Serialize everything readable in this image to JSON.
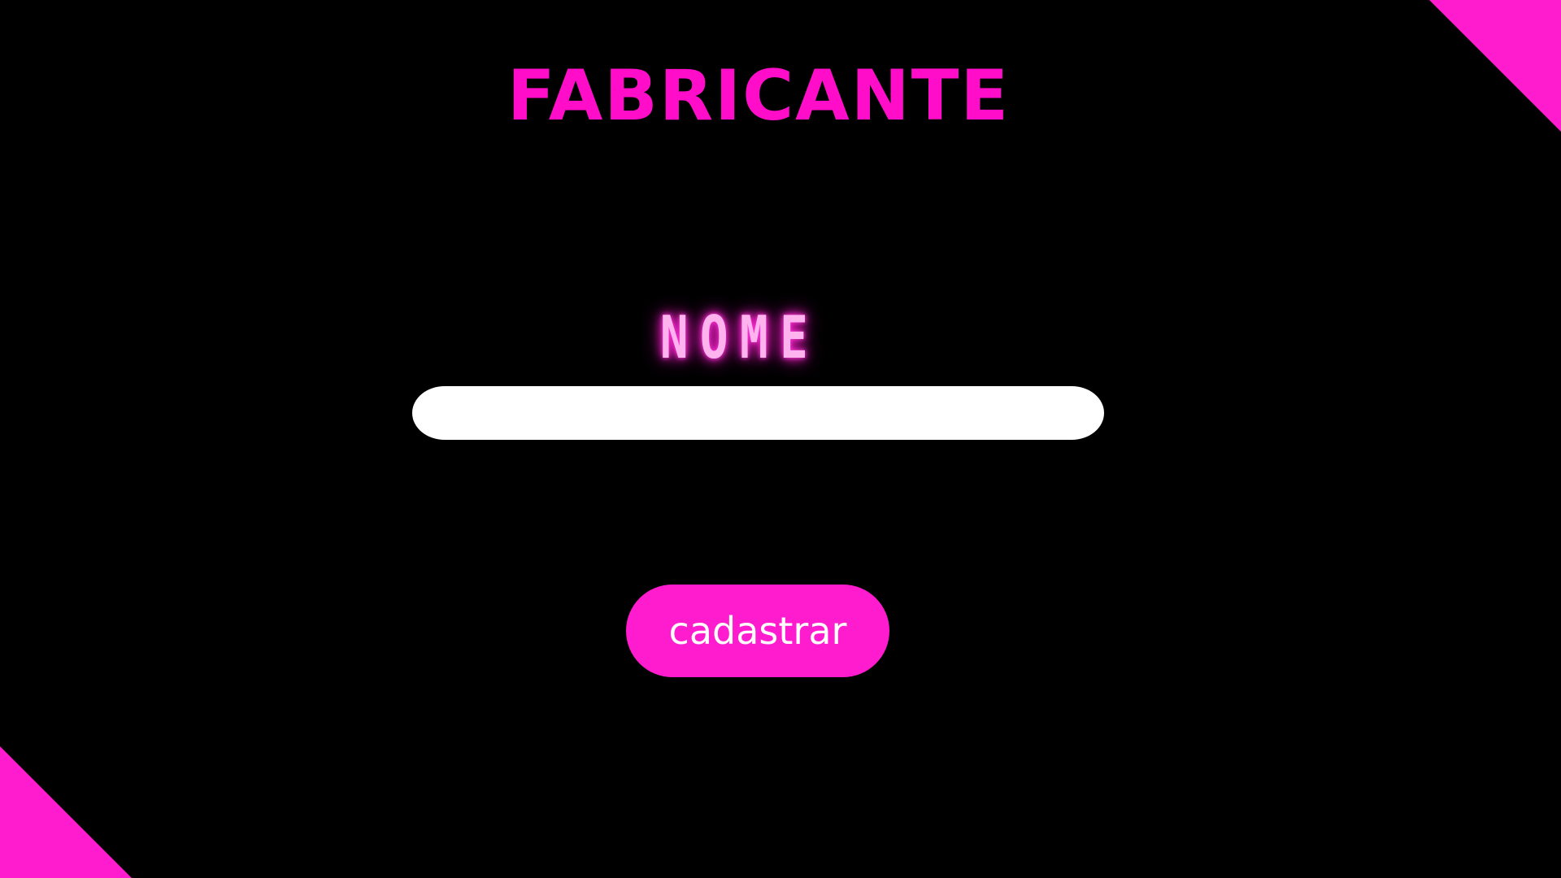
{
  "header": {
    "title": "FABRICANTE"
  },
  "form": {
    "name_label": "NOME",
    "name_value": "",
    "submit_label": "cadastrar"
  },
  "theme": {
    "background": "#000000",
    "accent": "#ff1ccf",
    "title_color": "#ff0dc9",
    "label_glow_color": "#ffb3ee",
    "input_background": "#ffffff",
    "button_text_color": "#ffffff"
  }
}
